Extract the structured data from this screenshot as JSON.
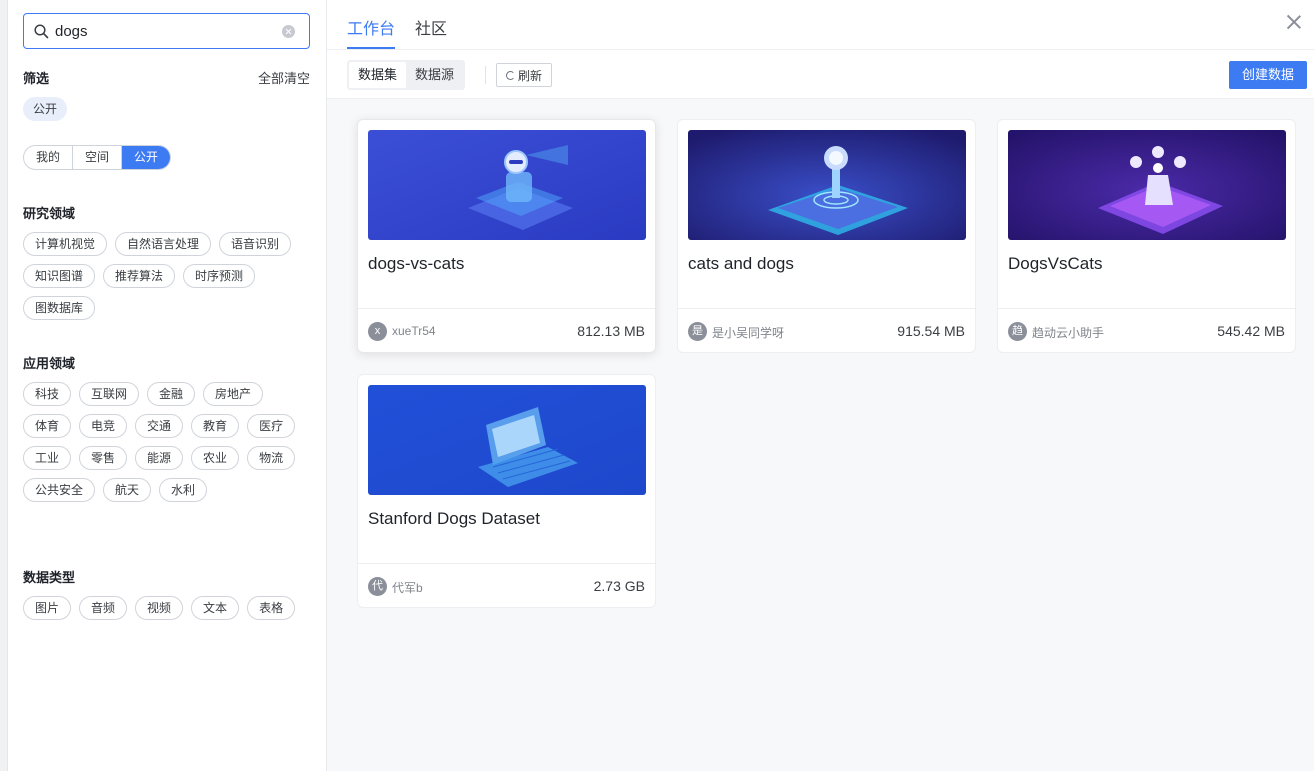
{
  "search": {
    "value": "dogs",
    "placeholder": ""
  },
  "filter": {
    "title": "筛选",
    "clear_label": "全部清空",
    "active_tag": "公开",
    "scope_tabs": [
      {
        "label": "我的",
        "selected": false
      },
      {
        "label": "空间",
        "selected": false
      },
      {
        "label": "公开",
        "selected": true
      }
    ]
  },
  "research": {
    "title": "研究领域",
    "tags": [
      "计算机视觉",
      "自然语言处理",
      "语音识别",
      "知识图谱",
      "推荐算法",
      "时序预测",
      "图数据库"
    ]
  },
  "application": {
    "title": "应用领域",
    "tags": [
      "科技",
      "互联网",
      "金融",
      "房地产",
      "体育",
      "电竞",
      "交通",
      "教育",
      "医疗",
      "工业",
      "零售",
      "能源",
      "农业",
      "物流",
      "公共安全",
      "航天",
      "水利"
    ]
  },
  "datatype": {
    "title": "数据类型",
    "tags": [
      "图片",
      "音频",
      "视频",
      "文本",
      "表格"
    ]
  },
  "header": {
    "tabs": [
      {
        "label": "工作台",
        "selected": true
      },
      {
        "label": "社区",
        "selected": false
      }
    ]
  },
  "toolbar": {
    "toggle": [
      {
        "label": "数据集",
        "selected": true
      },
      {
        "label": "数据源",
        "selected": false
      }
    ],
    "refresh_label": "刷新",
    "create_label": "创建数据"
  },
  "datasets": [
    {
      "name": "dogs-vs-cats",
      "avatar": "x",
      "author": "xueTr54",
      "size": "812.13 MB"
    },
    {
      "name": "cats and dogs",
      "avatar": "是",
      "author": "是小吴同学呀",
      "size": "915.54 MB"
    },
    {
      "name": "DogsVsCats",
      "avatar": "趋",
      "author": "趋动云小助手",
      "size": "545.42 MB"
    },
    {
      "name": "Stanford Dogs Dataset",
      "avatar": "代",
      "author": "代军b",
      "size": "2.73 GB"
    }
  ],
  "colors": {
    "accent": "#3d7bf2",
    "active_tag_bg": "#e9eefb"
  }
}
